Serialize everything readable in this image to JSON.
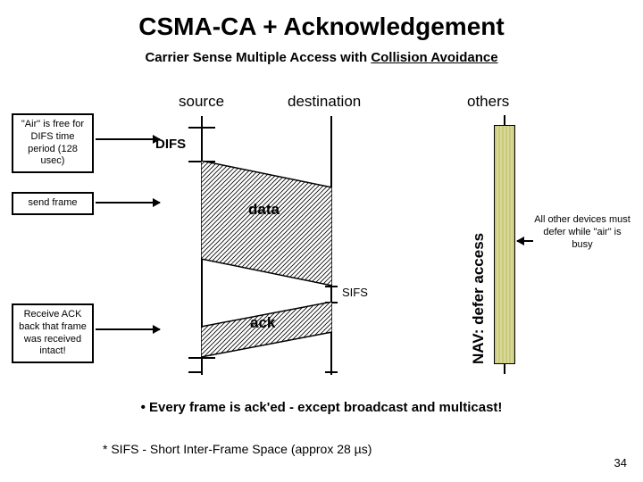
{
  "title": "CSMA-CA + Acknowledgement",
  "subtitle_prefix": "Carrier Sense Multiple Access with ",
  "subtitle_underlined": "Collision Avoidance",
  "columns": {
    "source": "source",
    "destination": "destination",
    "others": "others"
  },
  "labels": {
    "difs": "DIFS",
    "sifs": "SIFS",
    "data": "data",
    "ack": "ack",
    "nav": "NAV: defer access"
  },
  "annot": {
    "air_free": "\"Air\" is free for DIFS  time period (128 usec)",
    "send_frame": "send frame",
    "receive_ack": "Receive ACK back that frame was received intact!",
    "others_defer": "All other devices must defer while \"air\" is busy"
  },
  "bullet": "Every frame is ack'ed - except broadcast and multicast!",
  "footnote": "* SIFS - Short Inter-Frame Space (approx 28 µs)",
  "page": "34"
}
